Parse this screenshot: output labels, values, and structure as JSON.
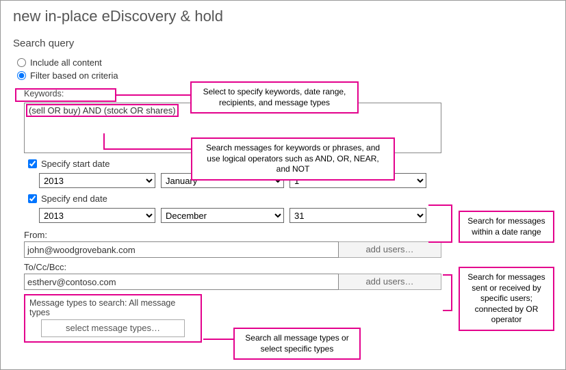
{
  "title": "new in-place eDiscovery & hold",
  "section": "Search query",
  "radios": {
    "include_all": "Include all content",
    "filter_criteria": "Filter based on criteria"
  },
  "keywords_label": "Keywords:",
  "keywords_value": "(sell OR buy) AND (stock OR shares)",
  "start_date_label": "Specify start date",
  "end_date_label": "Specify end date",
  "start": {
    "year": "2013",
    "month": "January",
    "day": "1"
  },
  "end": {
    "year": "2013",
    "month": "December",
    "day": "31"
  },
  "from_label": "From:",
  "from_value": "john@woodgrovebank.com",
  "to_label": "To/Cc/Bcc:",
  "to_value": "estherv@contoso.com",
  "add_users": "add users…",
  "msgtypes_label": "Message types to search:  All message types",
  "msgtypes_button": "select message types…",
  "callouts": {
    "criteria": "Select to specify keywords, date range, recipients, and message types",
    "keywords": "Search messages for keywords or phrases, and use logical operators such as AND, OR, NEAR, and NOT",
    "daterange": "Search for messages within a date range",
    "users": "Search for messages sent or received by specific users; connected by OR operator",
    "msgtypes": "Search all message types or select specific types"
  }
}
